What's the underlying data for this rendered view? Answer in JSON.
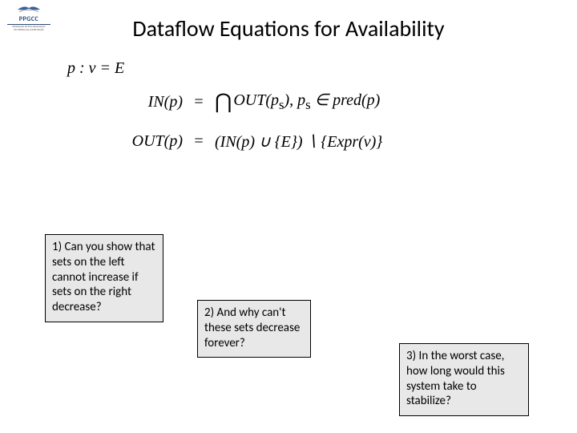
{
  "logo": {
    "abbr": "PPGCC",
    "sub1": "PROGRAMA DE PÓS-GRADUAÇÃO",
    "sub2": "EM CIÊNCIA DA COMPUTAÇÃO"
  },
  "title": "Dataflow Equations for Availability",
  "equations": {
    "premise": "p : v = E",
    "in_lhs": "IN(p)",
    "in_rhs_a": "OUT(p",
    "in_rhs_sub": "s",
    "in_rhs_b": "), p",
    "in_rhs_sub2": "s",
    "in_rhs_c": " ∈ pred(p)",
    "out_lhs": "OUT(p)",
    "out_rhs": "(IN(p) ∪ {E}) ∖ {Expr(v)}"
  },
  "callouts": {
    "q1": "1) Can you show that sets on the left cannot increase if sets on the right decrease?",
    "q2": "2) And why can't these sets decrease forever?",
    "q3": "3) In the worst case, how long would this system take to stabilize?"
  }
}
